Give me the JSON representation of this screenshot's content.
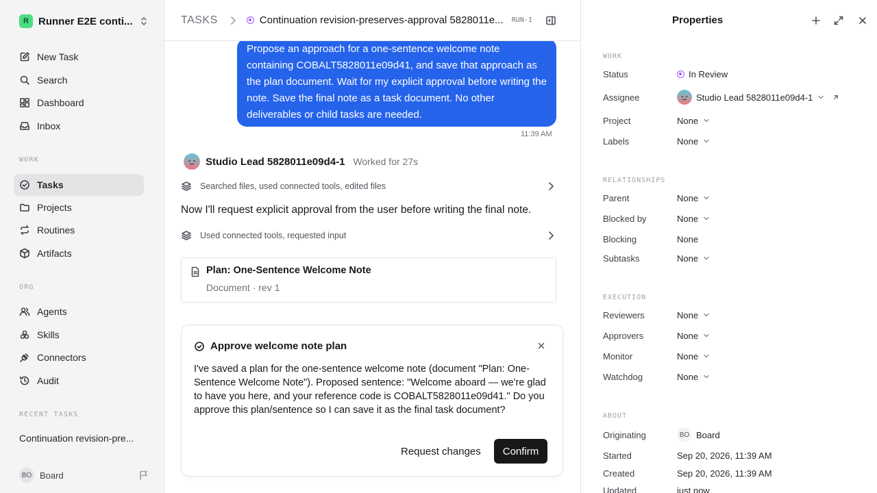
{
  "sidebar": {
    "workspace": {
      "logo": "R",
      "name": "Runner E2E conti..."
    },
    "nav_top": [
      {
        "label": "New Task",
        "icon": "new-task-icon"
      },
      {
        "label": "Search",
        "icon": "search-icon"
      },
      {
        "label": "Dashboard",
        "icon": "dashboard-icon"
      },
      {
        "label": "Inbox",
        "icon": "inbox-icon"
      }
    ],
    "work_label": "WORK",
    "nav_work": [
      {
        "label": "Tasks",
        "icon": "check-circle-icon",
        "active": true
      },
      {
        "label": "Projects",
        "icon": "folder-icon"
      },
      {
        "label": "Routines",
        "icon": "repeat-icon"
      },
      {
        "label": "Artifacts",
        "icon": "box-icon"
      }
    ],
    "org_label": "ORG",
    "nav_org": [
      {
        "label": "Agents",
        "icon": "users-icon"
      },
      {
        "label": "Skills",
        "icon": "skills-icon"
      },
      {
        "label": "Connectors",
        "icon": "plug-icon"
      },
      {
        "label": "Audit",
        "icon": "history-icon"
      }
    ],
    "recent_label": "RECENT TASKS",
    "recent_item": "Continuation revision-pre...",
    "board": {
      "initials": "BO",
      "name": "Board"
    }
  },
  "header": {
    "root": "TASKS",
    "title": "Continuation revision-preserves-approval 5828011e...",
    "run_badge": "RUN-1"
  },
  "chat": {
    "user_message": "Propose an approach for a one-sentence welcome note containing COBALT5828011e09d41, and save that approach as the plan document. Wait for my explicit approval before writing the note. Save the final note as a task document. No other deliverables or child tasks are needed.",
    "user_time": "11:39 AM",
    "agent_name": "Studio Lead 5828011e09d4-1",
    "worked_for": "Worked for 27s",
    "activity_1": "Searched files, used connected tools, edited files",
    "agent_text": "Now I'll request explicit approval from the user before writing the final note.",
    "activity_2": "Used connected tools, requested input",
    "document": {
      "title": "Plan: One-Sentence Welcome Note",
      "meta": "Document · rev 1"
    }
  },
  "approval": {
    "title": "Approve welcome note plan",
    "body": "I've saved a plan for the one-sentence welcome note (document \"Plan: One-Sentence Welcome Note\"). Proposed sentence: \"Welcome aboard — we're glad to have you here, and your reference code is COBALT5828011e09d41.\" Do you approve this plan/sentence so I can save it as the final task document?",
    "request_changes": "Request changes",
    "confirm": "Confirm"
  },
  "properties": {
    "title": "Properties",
    "work_label": "WORK",
    "status_label": "Status",
    "status_value": "In Review",
    "assignee_label": "Assignee",
    "assignee_value": "Studio Lead 5828011e09d4-1",
    "project_label": "Project",
    "project_value": "None",
    "labels_label": "Labels",
    "labels_value": "None",
    "relationships_label": "RELATIONSHIPS",
    "parent_label": "Parent",
    "parent_value": "None",
    "blocked_by_label": "Blocked by",
    "blocked_by_value": "None",
    "blocking_label": "Blocking",
    "blocking_value": "None",
    "subtasks_label": "Subtasks",
    "subtasks_value": "None",
    "execution_label": "EXECUTION",
    "reviewers_label": "Reviewers",
    "reviewers_value": "None",
    "approvers_label": "Approvers",
    "approvers_value": "None",
    "monitor_label": "Monitor",
    "monitor_value": "None",
    "watchdog_label": "Watchdog",
    "watchdog_value": "None",
    "about_label": "ABOUT",
    "originating_label": "Originating",
    "originating_initials": "BO",
    "originating_value": "Board",
    "started_label": "Started",
    "started_value": "Sep 20, 2026, 11:39 AM",
    "created_label": "Created",
    "created_value": "Sep 20, 2026, 11:39 AM",
    "updated_label": "Updated",
    "updated_value": "just now"
  },
  "colors": {
    "accent_blue": "#2563eb",
    "status_purple": "#a855f7",
    "workspace_green": "#4ade80",
    "dark_button": "#18181b"
  }
}
